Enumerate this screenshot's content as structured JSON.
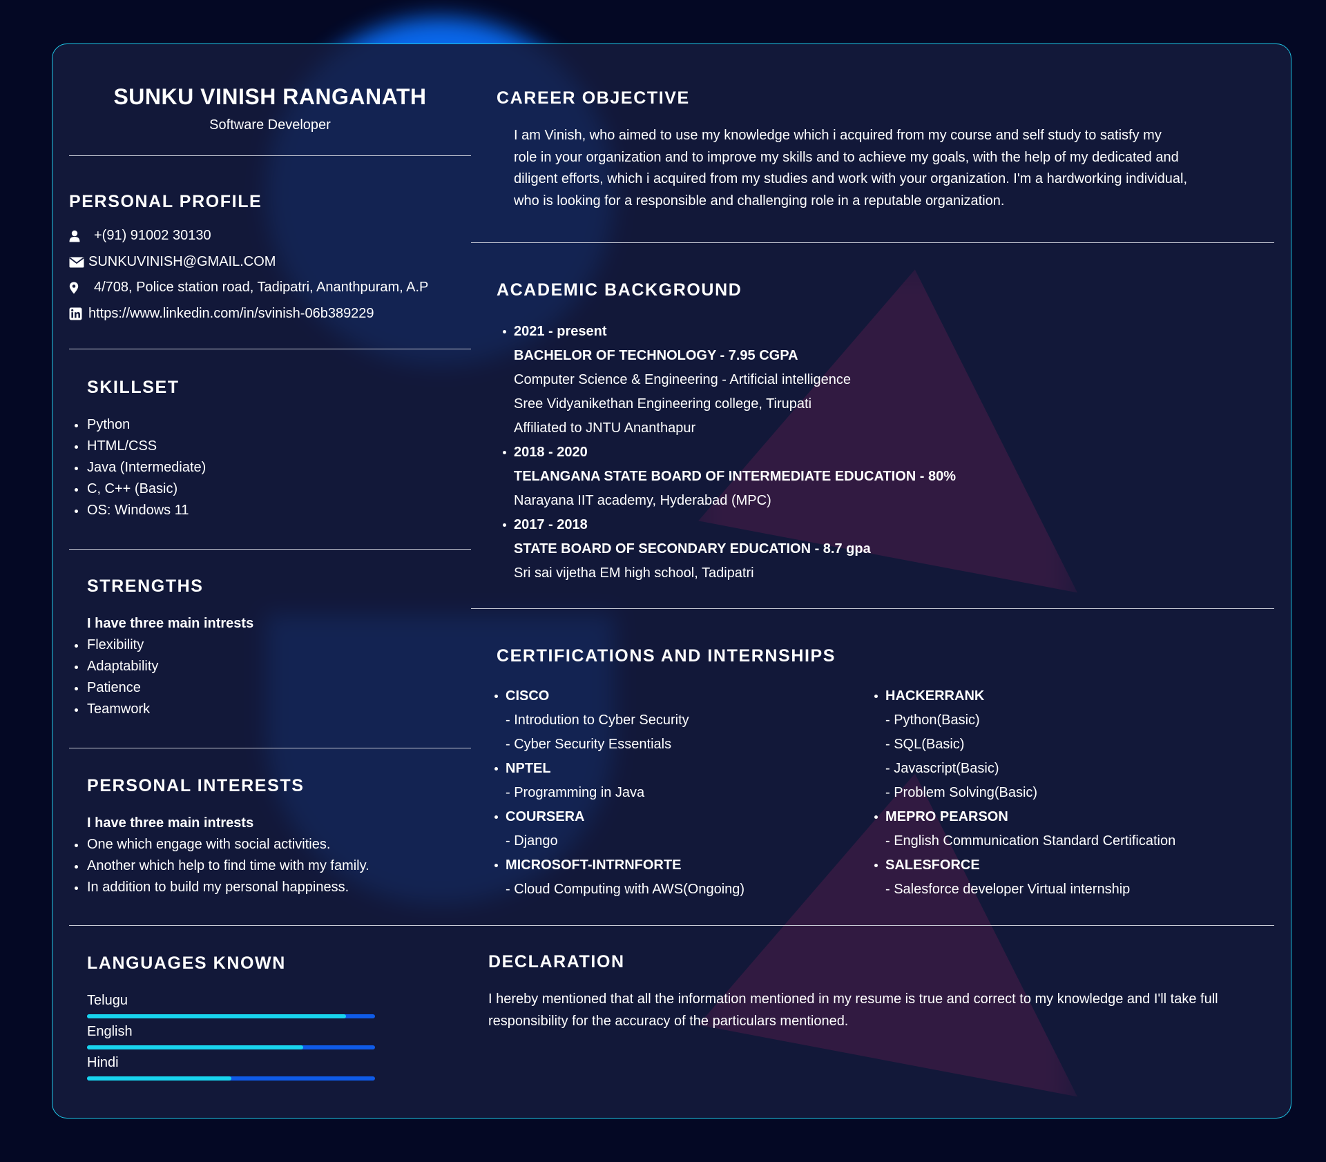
{
  "header": {
    "name": "SUNKU VINISH RANGANATH",
    "role": "Software Developer"
  },
  "personal_profile": {
    "title": "PERSONAL PROFILE",
    "phone": "+(91) 91002 30130",
    "email": "SUNKUVINISH@GMAIL.COM",
    "address": "4/708, Police station road, Tadipatri, Ananthpuram, A.P",
    "linkedin": "https://www.linkedin.com/in/svinish-06b389229",
    "icons": [
      "user-icon",
      "envelope-icon",
      "map-pin-icon",
      "linkedin-icon"
    ]
  },
  "skillset": {
    "title": "SKILLSET",
    "items": [
      "Python",
      "HTML/CSS",
      "Java (Intermediate)",
      "C, C++ (Basic)",
      "OS: Windows 11"
    ]
  },
  "strengths": {
    "title": "STRENGTHS",
    "intro": "I have three main intrests",
    "items": [
      "Flexibility",
      "Adaptability",
      "Patience",
      "Teamwork"
    ]
  },
  "personal_interests": {
    "title": "PERSONAL INTERESTS",
    "intro": "I have three main intrests",
    "items": [
      "One which engage with social activities.",
      "Another which help to find time with my family.",
      "In addition to build my personal happiness."
    ]
  },
  "languages": {
    "title": "LANGUAGES KNOWN",
    "items": [
      {
        "name": "Telugu",
        "level": 0.9
      },
      {
        "name": "English",
        "level": 0.75
      },
      {
        "name": "Hindi",
        "level": 0.5
      }
    ]
  },
  "career_objective": {
    "title": "CAREER OBJECTIVE",
    "lines": [
      "I am Vinish, who aimed to use my knowledge which i acquired from my course and self study to satisfy my",
      "role in your organization and to improve my skills and to achieve my goals, with the help of my dedicated and",
      "diligent efforts, which i acquired from my studies and work with your organization. I'm a hardworking individual,",
      "who is looking for a responsible and challenging role in a reputable organization."
    ]
  },
  "academic": {
    "title": "ACADEMIC BACKGROUND",
    "entries": [
      {
        "year": "2021 - present",
        "degree": "BACHELOR OF TECHNOLOGY - 7.95 CGPA",
        "details": [
          "Computer Science & Engineering - Artificial intelligence",
          "Sree Vidyanikethan Engineering college, Tirupati",
          "Affiliated to JNTU Ananthapur"
        ]
      },
      {
        "year": "2018 - 2020",
        "degree": "TELANGANA STATE BOARD OF INTERMEDIATE EDUCATION - 80%",
        "details": [
          "Narayana IIT academy, Hyderabad (MPC)"
        ]
      },
      {
        "year": "2017 - 2018",
        "degree": "STATE BOARD OF SECONDARY EDUCATION - 8.7 gpa",
        "details": [
          "Sri sai vijetha EM high school, Tadipatri"
        ]
      }
    ]
  },
  "certifications": {
    "title": "CERTIFICATIONS AND INTERNSHIPS",
    "left": [
      {
        "org": "CISCO",
        "items": [
          "- Introdution to Cyber Security",
          "- Cyber Security Essentials"
        ]
      },
      {
        "org": "NPTEL",
        "items": [
          "- Programming in Java"
        ]
      },
      {
        "org": "COURSERA",
        "items": [
          "- Django"
        ]
      },
      {
        "org": "MICROSOFT-INTRNFORTE",
        "items": [
          "- Cloud Computing with AWS(Ongoing)"
        ]
      }
    ],
    "right": [
      {
        "org": "HACKERRANK",
        "items": [
          "- Python(Basic)",
          "- SQL(Basic)",
          "- Javascript(Basic)",
          "- Problem Solving(Basic)"
        ]
      },
      {
        "org": "MEPRO PEARSON",
        "items": [
          "- English Communication Standard Certification"
        ]
      },
      {
        "org": "SALESFORCE",
        "items": [
          "- Salesforce developer Virtual internship"
        ]
      }
    ]
  },
  "declaration": {
    "title": "DECLARATION",
    "lines": [
      "I hereby mentioned that all the information mentioned in my resume is true and correct to my knowledge and I'll take full",
      "responsibility for the accuracy of the particulars mentioned."
    ]
  },
  "colors": {
    "background": "#040824",
    "card": "#141a3c",
    "border": "#1ec8e8",
    "blob_blue": "#0a6cf5",
    "blob_pink": "#ff1a66",
    "bar_fill": "#18d4ee",
    "bar_track": "#0f5be8"
  }
}
